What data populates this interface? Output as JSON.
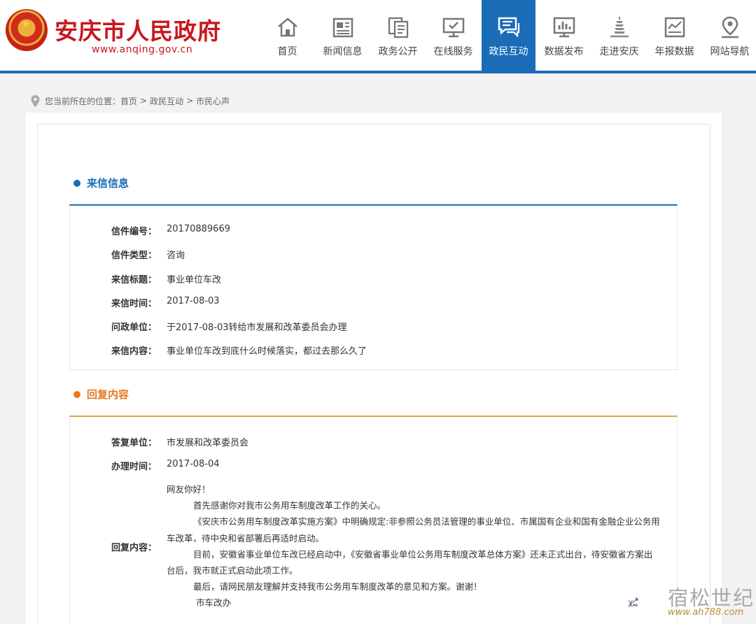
{
  "header": {
    "title": "安庆市人民政府",
    "url": "www.anqing.gov.cn",
    "nav": [
      {
        "label": "首页",
        "icon": "home-icon"
      },
      {
        "label": "新闻信息",
        "icon": "news-icon"
      },
      {
        "label": "政务公开",
        "icon": "documents-icon"
      },
      {
        "label": "在线服务",
        "icon": "monitor-icon"
      },
      {
        "label": "政民互动",
        "icon": "chat-icon",
        "active": true
      },
      {
        "label": "数据发布",
        "icon": "bar-chart-icon"
      },
      {
        "label": "走进安庆",
        "icon": "pagoda-icon"
      },
      {
        "label": "年报数据",
        "icon": "report-icon"
      },
      {
        "label": "网站导航",
        "icon": "location-pin-icon"
      }
    ]
  },
  "breadcrumb": {
    "prefix": "您当前所在的位置：",
    "items": [
      "首页",
      "政民互动",
      "市民心声"
    ],
    "separator": ">"
  },
  "letter": {
    "section_title": "来信信息",
    "fields": [
      {
        "label": "信件编号：",
        "value": "20170889669"
      },
      {
        "label": "信件类型：",
        "value": "咨询"
      },
      {
        "label": "来信标题：",
        "value": "事业单位车改"
      },
      {
        "label": "来信时间：",
        "value": "2017-08-03"
      },
      {
        "label": "问政单位：",
        "value": "于2017-08-03转给市发展和改革委员会办理"
      },
      {
        "label": "来信内容：",
        "value": "事业单位车改到底什么时候落实，都过去那么久了"
      }
    ]
  },
  "reply": {
    "section_title": "回复内容",
    "fields": [
      {
        "label": "答复单位：",
        "value": "市发展和改革委员会"
      },
      {
        "label": "办理时间：",
        "value": "2017-08-04"
      }
    ],
    "content_label": "回复内容：",
    "content": {
      "greeting": "网友你好！",
      "p1": "首先感谢你对我市公务用车制度改革工作的关心。",
      "p2a": "《安庆市公务用车制度改革实施方案》中明确规定:非参照公务员法管理的事业单位、市属国有企业和国有金融企业公务用",
      "p2b": "车改革，待中央和省部署后再适时启动。",
      "p3a": "目前，安徽省事业单位车改已经启动中，《安徽省事业单位公务用车制度改革总体方案》还未正式出台，待安徽省方案出",
      "p3b": "台后，我市就正式启动此项工作。",
      "p4": "最后，请网民朋友理解并支持我市公务用车制度改革的意见和方案。谢谢！",
      "signature": "市车改办"
    }
  },
  "watermark": {
    "text": "宿松世纪网",
    "url": "www.ah788.com"
  },
  "colors": {
    "brand_red": "#c9171e",
    "brand_blue": "#1a6cb7",
    "accent_orange": "#e8781e"
  }
}
